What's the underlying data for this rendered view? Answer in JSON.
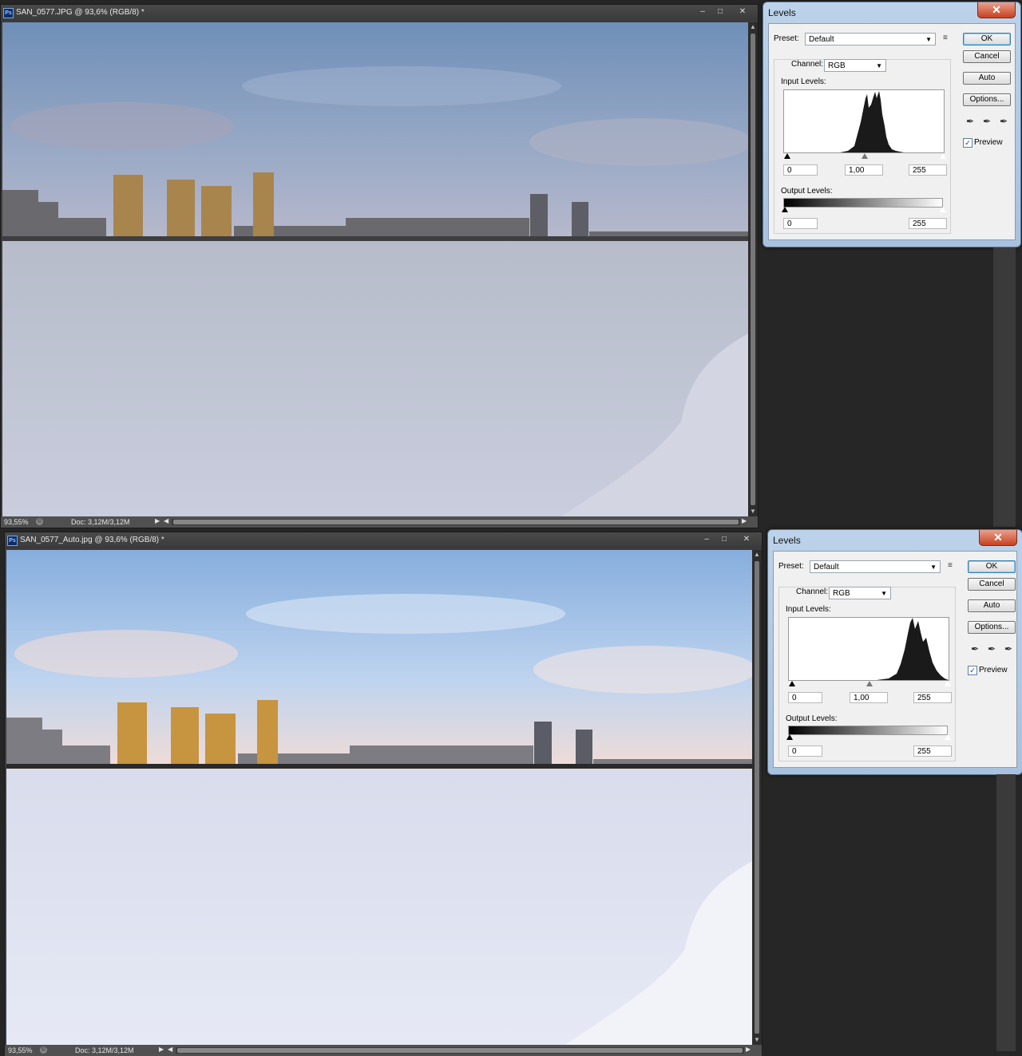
{
  "top_window": {
    "title": "SAN_0577.JPG @ 93,6% (RGB/8) *",
    "zoom": "93,55%",
    "doc_info": "Doc: 3,12M/3,12M"
  },
  "bottom_window": {
    "title": "SAN_0577_Auto.jpg @ 93,6% (RGB/8) *",
    "zoom": "93,55%",
    "doc_info": "Doc: 3,12M/3,12M"
  },
  "window_controls": {
    "minimize": "–",
    "maximize": "□",
    "close": "✕"
  },
  "levels": {
    "title": "Levels",
    "close_glyph": "✕",
    "preset_label": "Preset:",
    "preset_value": "Default",
    "channel_label": "Channel:",
    "channel_value": "RGB",
    "input_levels_label": "Input Levels:",
    "output_levels_label": "Output Levels:",
    "input_black": "0",
    "input_gamma": "1,00",
    "input_white": "255",
    "output_black": "0",
    "output_white": "255",
    "ok": "OK",
    "cancel": "Cancel",
    "auto": "Auto",
    "options": "Options...",
    "preview_label": "Preview",
    "preview_checked": true,
    "check_glyph": "✓",
    "dropdown_glyph": "▼",
    "menu_glyph": "≡",
    "eyedropper_glyph": "✒"
  },
  "icons": [
    "photoshop-icon",
    "eyedropper-black-icon",
    "eyedropper-gray-icon",
    "eyedropper-white-icon",
    "panel-menu-icon",
    "close-icon"
  ],
  "colors": {
    "app_background": "#262626",
    "dialog_frame": "#b4cce6",
    "close_button": "#c6421f",
    "ok_border": "#3c7fb1"
  }
}
